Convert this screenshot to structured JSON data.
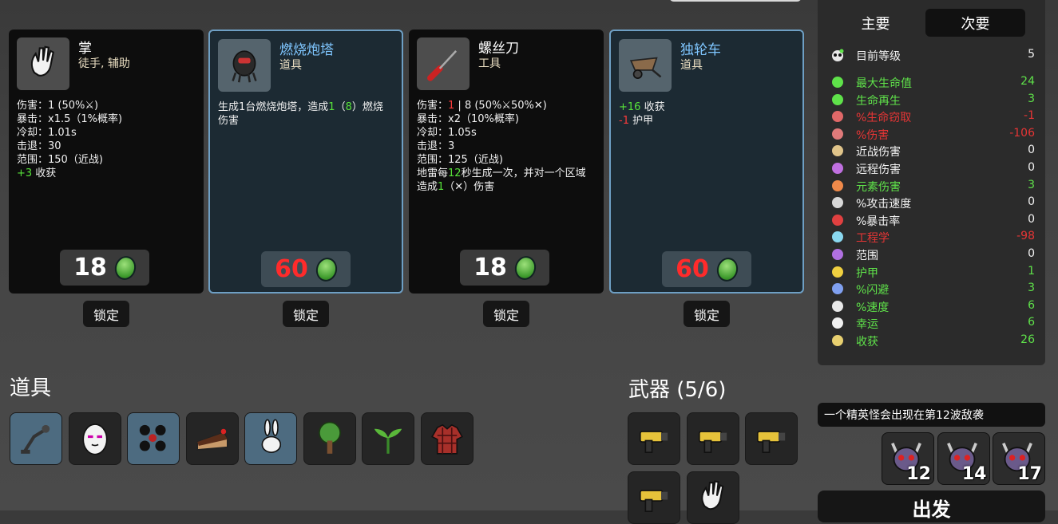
{
  "shop_cards": [
    {
      "name": "掌",
      "type": "徒手, 辅助",
      "price": "18",
      "price_color": "#ffffff",
      "kind": "weapon",
      "desc_lines": [
        [
          {
            "t": "伤害：1 (50%"
          },
          {
            "t": "⚔",
            "c": "w"
          },
          {
            "t": ")"
          }
        ],
        [
          {
            "t": "暴击：x1.5（1%概率)"
          }
        ],
        [
          {
            "t": "冷却：1.01s"
          }
        ],
        [
          {
            "t": "击退：30"
          }
        ],
        [
          {
            "t": "范围：150（近战)"
          }
        ],
        [
          {
            "t": "+3",
            "c": "g"
          },
          {
            "t": " 收获"
          }
        ]
      ]
    },
    {
      "name": "燃烧炮塔",
      "type": "道具",
      "price": "60",
      "price_color": "#ff2b2b",
      "kind": "item",
      "desc_lines": [
        [
          {
            "t": "生成1台燃烧炮塔，造成"
          },
          {
            "t": "1",
            "c": "g"
          },
          {
            "t": "（"
          },
          {
            "t": "8",
            "c": "g"
          },
          {
            "t": "）燃烧"
          }
        ],
        [
          {
            "t": "伤害"
          }
        ]
      ]
    },
    {
      "name": "螺丝刀",
      "type": "工具",
      "price": "18",
      "price_color": "#ffffff",
      "kind": "weapon",
      "desc_lines": [
        [
          {
            "t": "伤害："
          },
          {
            "t": "1",
            "c": "r"
          },
          {
            "t": " | 8 (50%⚔50%✕)"
          }
        ],
        [
          {
            "t": "暴击：x2（10%概率)"
          }
        ],
        [
          {
            "t": "冷却：1.05s"
          }
        ],
        [
          {
            "t": "击退：3"
          }
        ],
        [
          {
            "t": "范围：125（近战)"
          }
        ],
        [
          {
            "t": "地雷每"
          },
          {
            "t": "12",
            "c": "g"
          },
          {
            "t": "秒生成一次，并对一个区域"
          }
        ],
        [
          {
            "t": "造成"
          },
          {
            "t": "1",
            "c": "g"
          },
          {
            "t": "（✕）伤害"
          }
        ]
      ]
    },
    {
      "name": "独轮车",
      "type": "道具",
      "price": "60",
      "price_color": "#ff2b2b",
      "kind": "item",
      "desc_lines": [
        [
          {
            "t": "+16",
            "c": "g"
          },
          {
            "t": " 收获"
          }
        ],
        [
          {
            "t": "-1",
            "c": "r"
          },
          {
            "t": " 护甲"
          }
        ]
      ]
    }
  ],
  "lock_label": "锁定",
  "items_title": "道具",
  "weapons_title": "武器 (5/6)",
  "item_slots": [
    "hammer-lamp-icon",
    "egg-icon",
    "bombs-icon",
    "cake-slice-icon",
    "rabbit-icon",
    "tree-icon",
    "sprout-icon",
    "plaid-shirt-icon"
  ],
  "weapon_slots": [
    "taser-icon",
    "taser-icon",
    "taser-icon",
    "taser-icon",
    "hand-icon"
  ],
  "stats_panel": {
    "tabs": [
      "主要",
      "次要"
    ],
    "level": {
      "label": "目前等级",
      "value": "5"
    },
    "rows": [
      {
        "label": "最大生命值",
        "value": "24",
        "color": "g",
        "icon": "heart-icon",
        "ic": "#5fe24a"
      },
      {
        "label": "生命再生",
        "value": "3",
        "color": "g",
        "icon": "regen-cross-icon",
        "ic": "#5fe24a"
      },
      {
        "label": "%生命窃取",
        "value": "-1",
        "color": "r",
        "icon": "fangs-icon",
        "ic": "#e06868"
      },
      {
        "label": "%伤害",
        "value": "-106",
        "color": "r",
        "icon": "muscle-icon",
        "ic": "#e07a7a"
      },
      {
        "label": "近战伤害",
        "value": "0",
        "color": "w",
        "icon": "sword-icon",
        "ic": "#e0c48a"
      },
      {
        "label": "远程伤害",
        "value": "0",
        "color": "w",
        "icon": "bow-icon",
        "ic": "#c070e0"
      },
      {
        "label": "元素伤害",
        "value": "3",
        "color": "g",
        "icon": "flame-icon",
        "ic": "#f08a4a"
      },
      {
        "label": "%攻击速度",
        "value": "0",
        "color": "w",
        "icon": "hourglass-icon",
        "ic": "#d8d8d8"
      },
      {
        "label": "%暴击率",
        "value": "0",
        "color": "w",
        "icon": "crit-star-icon",
        "ic": "#e04040"
      },
      {
        "label": "工程学",
        "value": "-98",
        "color": "r",
        "icon": "wrench-cross-icon",
        "ic": "#8ad8f0"
      },
      {
        "label": "范围",
        "value": "0",
        "color": "w",
        "icon": "range-waves-icon",
        "ic": "#b070e0"
      },
      {
        "label": "护甲",
        "value": "1",
        "color": "g",
        "icon": "shield-icon",
        "ic": "#f0d040"
      },
      {
        "label": "%闪避",
        "value": "3",
        "color": "g",
        "icon": "dodge-icon",
        "ic": "#80a0f0"
      },
      {
        "label": "%速度",
        "value": "6",
        "color": "g",
        "icon": "boot-icon",
        "ic": "#e8e8e8"
      },
      {
        "label": "幸运",
        "value": "6",
        "color": "g",
        "icon": "dice-icon",
        "ic": "#f0f0f0"
      },
      {
        "label": "收获",
        "value": "26",
        "color": "g",
        "icon": "wheat-icon",
        "ic": "#e8d070"
      }
    ]
  },
  "wave_notice": "一个精英怪会出现在第12波敌袭",
  "wave_slots": [
    "12",
    "14",
    "17"
  ],
  "go_label": "出发"
}
